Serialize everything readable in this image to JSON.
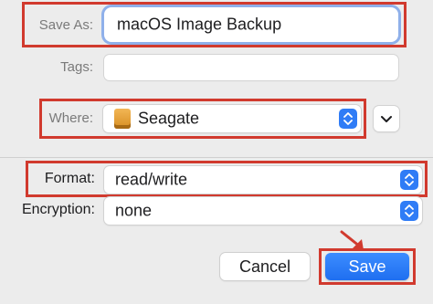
{
  "dialog": {
    "save_as": {
      "label": "Save As:",
      "value": "macOS Image Backup"
    },
    "tags": {
      "label": "Tags:",
      "value": ""
    },
    "where": {
      "label": "Where:",
      "value": "Seagate",
      "icon": "drive-icon"
    },
    "format": {
      "label": "Format:",
      "value": "read/write"
    },
    "encryption": {
      "label": "Encryption:",
      "value": "none"
    },
    "buttons": {
      "cancel": "Cancel",
      "save": "Save"
    }
  },
  "colors": {
    "highlight": "#d13a2e",
    "accent": "#2f7cf6",
    "focus_ring": "#8fb0ea"
  }
}
